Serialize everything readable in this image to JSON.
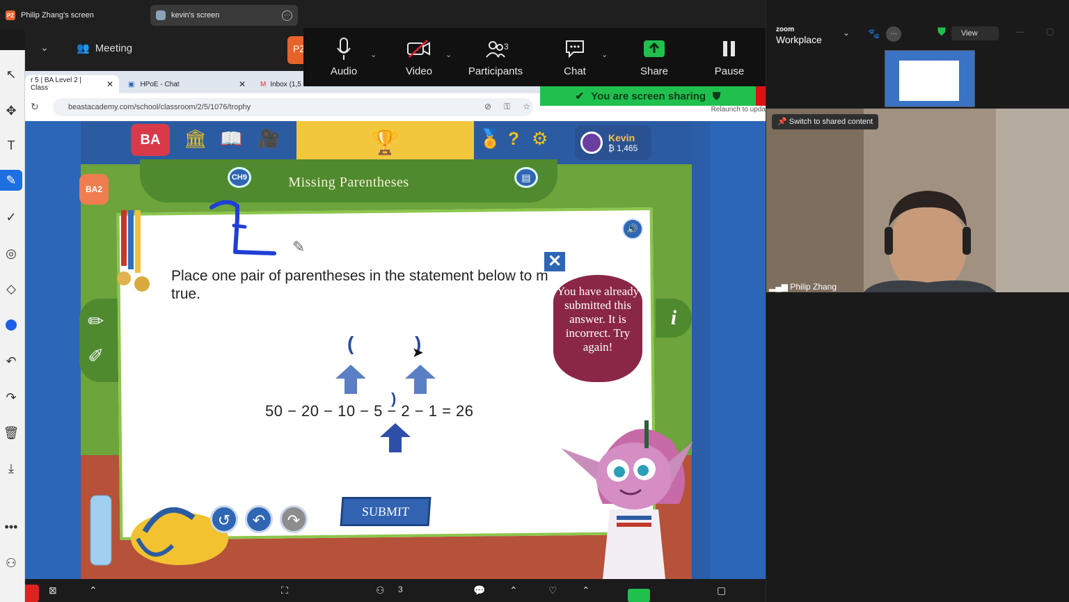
{
  "zoom_tabs": [
    {
      "label": "Philip Zhang's screen",
      "badge": "PZ"
    },
    {
      "label": "kevin's screen"
    }
  ],
  "meeting_label": "Meeting",
  "pz_badge": "PZ",
  "toolbar": {
    "audio": "Audio",
    "video": "Video",
    "participants": "Participants",
    "participants_count": "3",
    "chat": "Chat",
    "share": "Share",
    "pause": "Pause"
  },
  "sharing_banner": "You are screen sharing",
  "browser": {
    "tabs": [
      {
        "label": "r 5 | BA Level 2 | Class"
      },
      {
        "label": "HPoE - Chat"
      },
      {
        "label": "Inbox (1,5"
      }
    ],
    "url": "beastacademy.com/school/classroom/2/5/1076/trophy",
    "relaunch": "Relaunch to upda"
  },
  "game": {
    "logo": "BA",
    "level_badge": "BA2",
    "chapter_badge": "CH9",
    "user_name": "Kevin",
    "coins": "₿ 1,465",
    "title": "Missing Parentheses",
    "question": "Place one pair of parentheses in the statement below to m true.",
    "equation": "50 − 20 − 10 − 5 − 2 − 1 = 26",
    "paren_open": "(",
    "paren_close": ")",
    "paren_mid": ")",
    "feedback": "You have already submitted this answer. It is incorrect. Try again!",
    "submit_label": "SUBMIT",
    "close_label": "✕",
    "info_label": "i"
  },
  "right_panel": {
    "logo_small": "zoom",
    "logo_big": "Workplace",
    "view_label": "View",
    "switch_label": "Switch to shared content",
    "participant_name": "Philip Zhang"
  },
  "bottom_bar": {
    "participants_count": "3"
  },
  "colors": {
    "zoom_green": "#20c04e",
    "ba_blue": "#2f66b4",
    "ba_green": "#4f8a2e",
    "bubble_red": "#8a2746"
  }
}
